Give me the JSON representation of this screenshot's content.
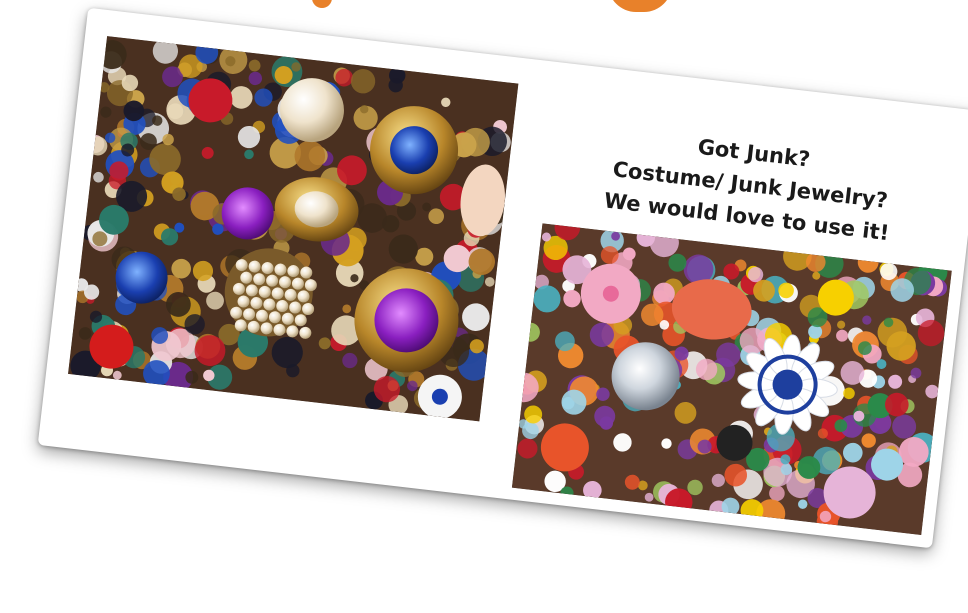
{
  "flyer": {
    "headline_lines": [
      "Got Junk?",
      "Costume/ Junk Jewelry?",
      "We would love to use it!"
    ]
  },
  "images": {
    "left": "jewelry-pile-photo",
    "right": "bead-and-jewelry-pile-photo"
  },
  "colors": {
    "background": "#ffffff",
    "text": "#1a1a1a",
    "accent_orange": "#e8812a"
  }
}
